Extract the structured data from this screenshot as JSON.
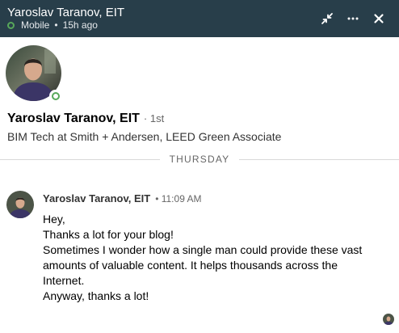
{
  "header": {
    "name": "Yaroslav Taranov, EIT",
    "status": "Mobile",
    "last_seen": "15h ago",
    "separator": "•"
  },
  "profile": {
    "name": "Yaroslav Taranov, EIT",
    "degree": "· 1st",
    "headline": "BIM Tech at Smith + Andersen, LEED Green Associate"
  },
  "divider": {
    "label": "THURSDAY"
  },
  "message": {
    "sender": "Yaroslav Taranov, EIT",
    "time": "• 11:09 AM",
    "lines": [
      "Hey,",
      "Thanks a lot for your blog!",
      "Sometimes I wonder how a single man could provide these vast",
      "amounts of valuable content. It helps thousands across the",
      "Internet.",
      "Anyway, thanks a lot!"
    ]
  },
  "colors": {
    "header_bg": "#283e4a",
    "online_green": "#57a85a"
  },
  "icons": {
    "minimize": "minimize-arrows-icon",
    "more": "ellipsis-icon",
    "close": "close-icon"
  }
}
